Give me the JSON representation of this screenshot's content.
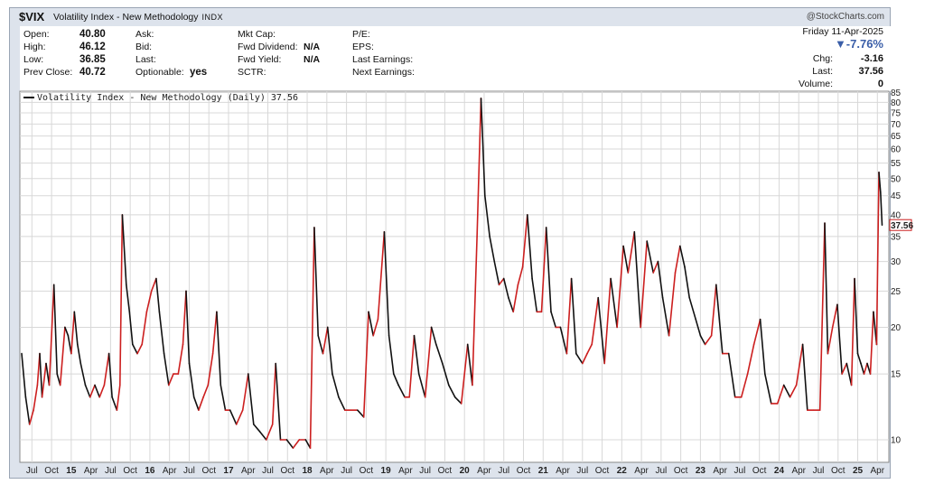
{
  "header": {
    "symbol": "$VIX",
    "name": "Volatility Index - New Methodology",
    "exchange": "INDX",
    "brand": "@StockCharts.com"
  },
  "quote": {
    "open_label": "Open:",
    "open": "40.80",
    "high_label": "High:",
    "high": "46.12",
    "low_label": "Low:",
    "low": "36.85",
    "prev_close_label": "Prev Close:",
    "prev_close": "40.72",
    "ask_label": "Ask:",
    "bid_label": "Bid:",
    "last_label": "Last:",
    "optionable_label": "Optionable:",
    "optionable": "yes",
    "mkt_cap_label": "Mkt Cap:",
    "fwd_div_label": "Fwd Dividend:",
    "fwd_div": "N/A",
    "fwd_yield_label": "Fwd Yield:",
    "fwd_yield": "N/A",
    "sctr_label": "SCTR:",
    "pe_label": "P/E:",
    "eps_label": "EPS:",
    "last_earn_label": "Last Earnings:",
    "next_earn_label": "Next Earnings:",
    "date": "Friday  11-Apr-2025",
    "pct_change": "▼-7.76%",
    "chg_label": "Chg:",
    "chg": "-3.16",
    "last2_label": "Last:",
    "last2": "37.56",
    "volume_label": "Volume:",
    "volume": "0"
  },
  "legend": {
    "text": "Volatility Index - New Methodology (Daily) 37.56"
  },
  "colors": {
    "line": "#cc1f1f",
    "down": "#111111",
    "grid": "#d8d8d8",
    "last_box": "#cc1f1f"
  },
  "chart_data": {
    "type": "line",
    "scale": "log",
    "series_label": "Volatility Index - New Methodology (Daily) 37.56",
    "last_value": "37.56",
    "ylim": [
      9,
      85
    ],
    "yticks": [
      10,
      15,
      20,
      25,
      30,
      35,
      40,
      45,
      50,
      55,
      60,
      65,
      70,
      75,
      80,
      85
    ],
    "xlim": [
      2014.37,
      2025.35
    ],
    "xticks": [
      {
        "label": "Jul",
        "x": 2014.5
      },
      {
        "label": "Oct",
        "x": 2014.75
      },
      {
        "label": "15",
        "x": 2015.0,
        "year": true
      },
      {
        "label": "Apr",
        "x": 2015.25
      },
      {
        "label": "Jul",
        "x": 2015.5
      },
      {
        "label": "Oct",
        "x": 2015.75
      },
      {
        "label": "16",
        "x": 2016.0,
        "year": true
      },
      {
        "label": "Apr",
        "x": 2016.25
      },
      {
        "label": "Jul",
        "x": 2016.5
      },
      {
        "label": "Oct",
        "x": 2016.75
      },
      {
        "label": "17",
        "x": 2017.0,
        "year": true
      },
      {
        "label": "Apr",
        "x": 2017.25
      },
      {
        "label": "Jul",
        "x": 2017.5
      },
      {
        "label": "Oct",
        "x": 2017.75
      },
      {
        "label": "18",
        "x": 2018.0,
        "year": true
      },
      {
        "label": "Apr",
        "x": 2018.25
      },
      {
        "label": "Jul",
        "x": 2018.5
      },
      {
        "label": "Oct",
        "x": 2018.75
      },
      {
        "label": "19",
        "x": 2019.0,
        "year": true
      },
      {
        "label": "Apr",
        "x": 2019.25
      },
      {
        "label": "Jul",
        "x": 2019.5
      },
      {
        "label": "Oct",
        "x": 2019.75
      },
      {
        "label": "20",
        "x": 2020.0,
        "year": true
      },
      {
        "label": "Apr",
        "x": 2020.25
      },
      {
        "label": "Jul",
        "x": 2020.5
      },
      {
        "label": "Oct",
        "x": 2020.75
      },
      {
        "label": "21",
        "x": 2021.0,
        "year": true
      },
      {
        "label": "Apr",
        "x": 2021.25
      },
      {
        "label": "Jul",
        "x": 2021.5
      },
      {
        "label": "Oct",
        "x": 2021.75
      },
      {
        "label": "22",
        "x": 2022.0,
        "year": true
      },
      {
        "label": "Apr",
        "x": 2022.25
      },
      {
        "label": "Jul",
        "x": 2022.5
      },
      {
        "label": "Oct",
        "x": 2022.75
      },
      {
        "label": "23",
        "x": 2023.0,
        "year": true
      },
      {
        "label": "Apr",
        "x": 2023.25
      },
      {
        "label": "Jul",
        "x": 2023.5
      },
      {
        "label": "Oct",
        "x": 2023.75
      },
      {
        "label": "24",
        "x": 2024.0,
        "year": true
      },
      {
        "label": "Apr",
        "x": 2024.25
      },
      {
        "label": "Jul",
        "x": 2024.5
      },
      {
        "label": "Oct",
        "x": 2024.75
      },
      {
        "label": "25",
        "x": 2025.0,
        "year": true
      },
      {
        "label": "Apr",
        "x": 2025.25
      }
    ],
    "grid": true,
    "points": [
      [
        2014.37,
        17
      ],
      [
        2014.42,
        13
      ],
      [
        2014.47,
        11
      ],
      [
        2014.52,
        12
      ],
      [
        2014.57,
        14
      ],
      [
        2014.6,
        17
      ],
      [
        2014.63,
        13
      ],
      [
        2014.68,
        16
      ],
      [
        2014.72,
        14
      ],
      [
        2014.78,
        26
      ],
      [
        2014.82,
        15
      ],
      [
        2014.86,
        14
      ],
      [
        2014.92,
        20
      ],
      [
        2014.96,
        19
      ],
      [
        2015.0,
        17
      ],
      [
        2015.04,
        22
      ],
      [
        2015.08,
        18
      ],
      [
        2015.12,
        16
      ],
      [
        2015.18,
        14
      ],
      [
        2015.24,
        13
      ],
      [
        2015.3,
        14
      ],
      [
        2015.36,
        13
      ],
      [
        2015.42,
        14
      ],
      [
        2015.48,
        17
      ],
      [
        2015.52,
        13
      ],
      [
        2015.58,
        12
      ],
      [
        2015.62,
        14
      ],
      [
        2015.65,
        40
      ],
      [
        2015.7,
        26
      ],
      [
        2015.74,
        22
      ],
      [
        2015.78,
        18
      ],
      [
        2015.84,
        17
      ],
      [
        2015.9,
        18
      ],
      [
        2015.96,
        22
      ],
      [
        2016.02,
        25
      ],
      [
        2016.08,
        27
      ],
      [
        2016.12,
        22
      ],
      [
        2016.18,
        17
      ],
      [
        2016.24,
        14
      ],
      [
        2016.3,
        15
      ],
      [
        2016.36,
        15
      ],
      [
        2016.42,
        18
      ],
      [
        2016.46,
        25
      ],
      [
        2016.5,
        16
      ],
      [
        2016.56,
        13
      ],
      [
        2016.62,
        12
      ],
      [
        2016.68,
        13
      ],
      [
        2016.74,
        14
      ],
      [
        2016.8,
        17
      ],
      [
        2016.85,
        22
      ],
      [
        2016.9,
        14
      ],
      [
        2016.96,
        12
      ],
      [
        2017.02,
        12
      ],
      [
        2017.1,
        11
      ],
      [
        2017.18,
        12
      ],
      [
        2017.25,
        15
      ],
      [
        2017.32,
        11
      ],
      [
        2017.4,
        10.5
      ],
      [
        2017.48,
        10
      ],
      [
        2017.56,
        11
      ],
      [
        2017.6,
        16
      ],
      [
        2017.66,
        10
      ],
      [
        2017.74,
        10
      ],
      [
        2017.82,
        9.5
      ],
      [
        2017.9,
        10
      ],
      [
        2017.98,
        10
      ],
      [
        2018.04,
        9.5
      ],
      [
        2018.09,
        37
      ],
      [
        2018.14,
        19
      ],
      [
        2018.2,
        17
      ],
      [
        2018.26,
        20
      ],
      [
        2018.32,
        15
      ],
      [
        2018.4,
        13
      ],
      [
        2018.48,
        12
      ],
      [
        2018.56,
        12
      ],
      [
        2018.64,
        12
      ],
      [
        2018.72,
        11.5
      ],
      [
        2018.78,
        22
      ],
      [
        2018.84,
        19
      ],
      [
        2018.9,
        21
      ],
      [
        2018.98,
        36
      ],
      [
        2019.04,
        19
      ],
      [
        2019.1,
        15
      ],
      [
        2019.16,
        14
      ],
      [
        2019.24,
        13
      ],
      [
        2019.3,
        13
      ],
      [
        2019.36,
        19
      ],
      [
        2019.42,
        15
      ],
      [
        2019.5,
        13
      ],
      [
        2019.58,
        20
      ],
      [
        2019.64,
        18
      ],
      [
        2019.72,
        16
      ],
      [
        2019.8,
        14
      ],
      [
        2019.88,
        13
      ],
      [
        2019.96,
        12.5
      ],
      [
        2020.04,
        18
      ],
      [
        2020.1,
        14
      ],
      [
        2020.16,
        35
      ],
      [
        2020.21,
        82
      ],
      [
        2020.26,
        45
      ],
      [
        2020.32,
        35
      ],
      [
        2020.38,
        30
      ],
      [
        2020.44,
        26
      ],
      [
        2020.5,
        27
      ],
      [
        2020.56,
        24
      ],
      [
        2020.62,
        22
      ],
      [
        2020.68,
        26
      ],
      [
        2020.74,
        29
      ],
      [
        2020.8,
        40
      ],
      [
        2020.86,
        27
      ],
      [
        2020.92,
        22
      ],
      [
        2020.98,
        22
      ],
      [
        2021.04,
        37
      ],
      [
        2021.1,
        22
      ],
      [
        2021.16,
        20
      ],
      [
        2021.22,
        20
      ],
      [
        2021.3,
        17
      ],
      [
        2021.36,
        27
      ],
      [
        2021.42,
        17
      ],
      [
        2021.5,
        16
      ],
      [
        2021.56,
        17
      ],
      [
        2021.62,
        18
      ],
      [
        2021.7,
        24
      ],
      [
        2021.78,
        16
      ],
      [
        2021.86,
        27
      ],
      [
        2021.94,
        20
      ],
      [
        2022.02,
        33
      ],
      [
        2022.08,
        28
      ],
      [
        2022.16,
        36
      ],
      [
        2022.24,
        20
      ],
      [
        2022.32,
        34
      ],
      [
        2022.4,
        28
      ],
      [
        2022.46,
        30
      ],
      [
        2022.52,
        24
      ],
      [
        2022.6,
        19
      ],
      [
        2022.68,
        28
      ],
      [
        2022.74,
        33
      ],
      [
        2022.8,
        29
      ],
      [
        2022.86,
        24
      ],
      [
        2022.94,
        21
      ],
      [
        2023.0,
        19
      ],
      [
        2023.06,
        18
      ],
      [
        2023.14,
        19
      ],
      [
        2023.2,
        26
      ],
      [
        2023.28,
        17
      ],
      [
        2023.36,
        17
      ],
      [
        2023.44,
        13
      ],
      [
        2023.52,
        13
      ],
      [
        2023.6,
        15
      ],
      [
        2023.68,
        18
      ],
      [
        2023.76,
        21
      ],
      [
        2023.82,
        15
      ],
      [
        2023.9,
        12.5
      ],
      [
        2023.98,
        12.5
      ],
      [
        2024.06,
        14
      ],
      [
        2024.14,
        13
      ],
      [
        2024.22,
        14
      ],
      [
        2024.3,
        18
      ],
      [
        2024.36,
        12
      ],
      [
        2024.44,
        12
      ],
      [
        2024.52,
        12
      ],
      [
        2024.58,
        38
      ],
      [
        2024.62,
        17
      ],
      [
        2024.68,
        20
      ],
      [
        2024.74,
        23
      ],
      [
        2024.8,
        15
      ],
      [
        2024.86,
        16
      ],
      [
        2024.92,
        14
      ],
      [
        2024.96,
        27
      ],
      [
        2025.0,
        17
      ],
      [
        2025.04,
        16
      ],
      [
        2025.08,
        15
      ],
      [
        2025.12,
        16
      ],
      [
        2025.16,
        15
      ],
      [
        2025.2,
        22
      ],
      [
        2025.24,
        18
      ],
      [
        2025.27,
        52
      ],
      [
        2025.29,
        46
      ],
      [
        2025.31,
        37.56
      ]
    ]
  }
}
